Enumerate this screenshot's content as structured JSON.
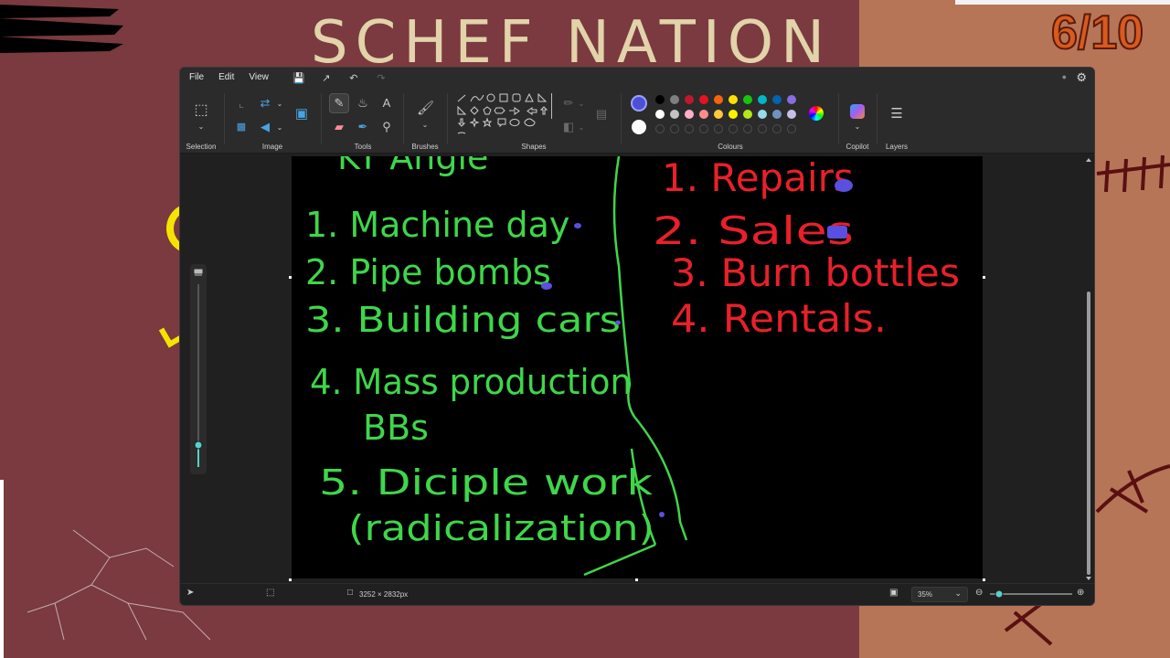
{
  "background": {
    "title_text": "SCHEF NATION",
    "counter": "6/10"
  },
  "window": {
    "menu": [
      "File",
      "Edit",
      "View"
    ],
    "ribbon": {
      "selection_label": "Selection",
      "image_label": "Image",
      "tools_label": "Tools",
      "brushes_label": "Brushes",
      "shapes_label": "Shapes",
      "colours_label": "Colours",
      "copilot_label": "Copilot",
      "layers_label": "Layers"
    },
    "colours": {
      "current_primary": "#4f4fd6",
      "current_secondary": "#ffffff",
      "row1": [
        "#000000",
        "#7f7f7f",
        "#c0182b",
        "#e81123",
        "#f7630c",
        "#fce100",
        "#16c60c",
        "#00b7c3",
        "#0063b1",
        "#886ce4"
      ],
      "row2": [
        "#ffffff",
        "#c3c3c3",
        "#ffaec9",
        "#ff8c8c",
        "#ffc83d",
        "#fff100",
        "#b5e61d",
        "#99d9ea",
        "#7092be",
        "#c8bfe7"
      ]
    },
    "status": {
      "canvas_size": "3252 × 2832px",
      "zoom": "35%"
    }
  },
  "drawing": {
    "left_heading": "KT Angle",
    "left_items": [
      "1. Machine day",
      "2. Pipe bombs",
      "3. Building cars",
      "4. Mass production",
      "BBs",
      "5. Diciple work",
      "(radicalization)"
    ],
    "right_items": [
      "1. Repairs",
      "2. Sales",
      "3. Burn bottles",
      "4. Rentals."
    ],
    "left_color": "#3fd64a",
    "right_color": "#e8202a",
    "marker_color": "#5a4fe0"
  }
}
